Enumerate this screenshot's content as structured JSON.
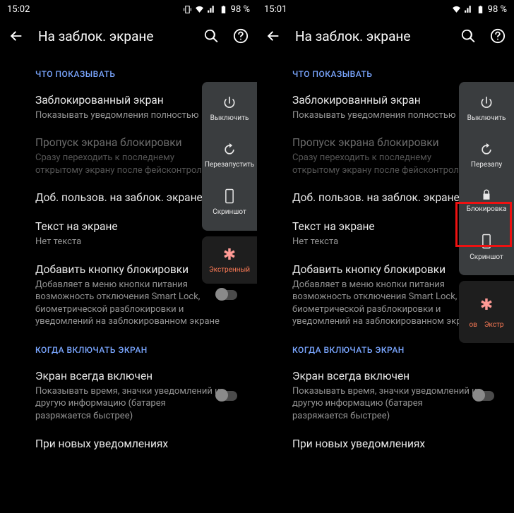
{
  "left": {
    "status": {
      "time": "15:02",
      "battery": "98 %"
    },
    "appbar": {
      "title": "На заблок. экране"
    },
    "section1": "ЧТО ПОКАЗЫВАТЬ",
    "pref_locked": {
      "title": "Заблокированный экран",
      "sub": "Показывать уведомления полностью"
    },
    "pref_skip": {
      "title": "Пропуск экрана блокировки",
      "sub": "Сразу переходить к последнему открытому экрану после фейсконтроля"
    },
    "pref_adduser": {
      "title": "Доб. пользов. на заблок. экране"
    },
    "pref_text": {
      "title": "Текст на экране",
      "sub": "Нет текста"
    },
    "pref_addlock": {
      "title": "Добавить кнопку блокировки",
      "sub": "Добавляет в меню кнопки питания возможность отключения Smart Lock, биометрической разблокировки и уведомлений на заблокированном экране"
    },
    "section2": "КОГДА ВКЛЮЧАТЬ ЭКРАН",
    "pref_aod": {
      "title": "Экран всегда включен",
      "sub": "Показывать время, значки уведомлений и другую информацию (батарея разряжается быстрее)"
    },
    "pref_newnotif": {
      "title": "При новых уведомлениях"
    },
    "power_menu": {
      "off": "Выключить",
      "restart": "Перезапустить",
      "screenshot": "Скриншот",
      "emergency": "Экстренный"
    }
  },
  "right": {
    "status": {
      "time": "15:01",
      "battery": "98 %"
    },
    "appbar": {
      "title": "На заблок. экране"
    },
    "section1": "ЧТО ПОКАЗЫВАТЬ",
    "pref_locked": {
      "title": "Заблокированный экран",
      "sub": "Показывать уведомления полностью"
    },
    "pref_skip": {
      "title": "Пропуск экрана блокировки",
      "sub": "Сразу переходить к последнему открытому экрану после фейсконтроля"
    },
    "pref_adduser": {
      "title": "Доб. пользов. на заблок. экране"
    },
    "pref_text": {
      "title": "Текст на экране",
      "sub": "Нет текста"
    },
    "pref_addlock": {
      "title": "Добавить кнопку блокировки",
      "sub": "Добавляет в меню кнопки питания возможность отключения Smart Lock, биометрической разблокировки и уведомлений на заблокированном экране"
    },
    "section2": "КОГДА ВКЛЮЧАТЬ ЭКРАН",
    "pref_aod": {
      "title": "Экран всегда включен",
      "sub": "Показывать время, значки уведомлений и другую информацию (батарея разряжается быстрее)"
    },
    "pref_newnotif": {
      "title": "При новых уведомлениях"
    },
    "power_menu": {
      "off": "Выключить",
      "restart": "Перезапу",
      "lock": "Блокировка",
      "screenshot": "Скриншот",
      "frag_ov": "ов",
      "frag_ex": "Экстр"
    }
  }
}
